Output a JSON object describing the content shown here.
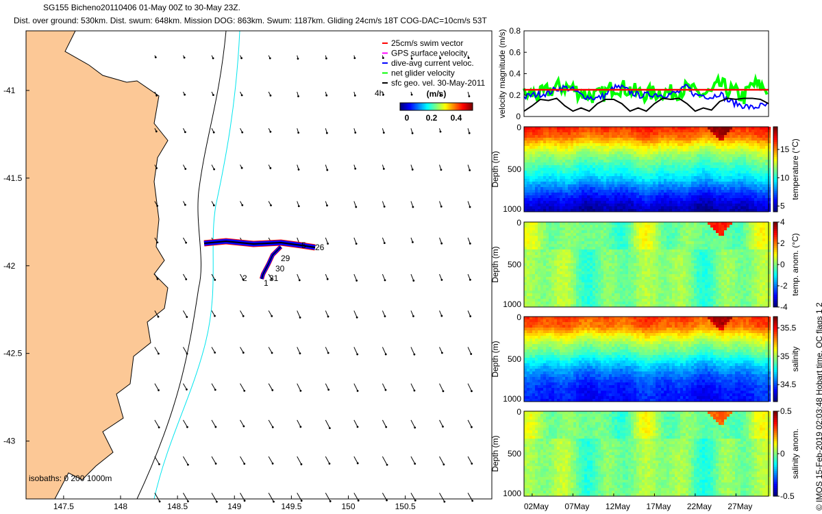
{
  "title": {
    "line1": "SG155 Bicheno20110406 01-May 00Z to 30-May 23Z.",
    "line2": "Dist. over ground: 530km. Dist. swum: 648km. Mission DOG: 863km. Swum: 1187km. Gliding 24cm/s 18T COG-DAC=10cm/s 53T"
  },
  "side_note": "© IMOS 15-Feb-2019 02:03:48 Hobart time. QC flags 1  2",
  "colors": {
    "land": "#fcc896",
    "isobath_200": "#000000",
    "isobath_1000": "#00e5ee",
    "swim": "#ff0000",
    "gps": "#ff00ff",
    "dac": "#0000ff",
    "net": "#00ff00",
    "geo": "#000000"
  },
  "chart_data": [
    {
      "type": "map",
      "xticks": [
        "147.5",
        "148",
        "148.5",
        "149",
        "149.5",
        "150",
        "150.5"
      ],
      "yticks": [
        "-41",
        "-41.5",
        "-42",
        "-42.5",
        "-43"
      ],
      "xlim": [
        147.17,
        151.26
      ],
      "ylim": [
        -43.33,
        -40.66
      ],
      "legend": {
        "placement": "top-right",
        "entries": [
          "25cm/s swim vector",
          "GPS surface velocity",
          "dive-avg current veloc.",
          "net glider velocity",
          "sfc geo. vel. 30-May-2011"
        ],
        "colorbar_title": "(m/s)",
        "colorbar_ticks": [
          "0",
          "0.2",
          "0.4"
        ]
      },
      "isobaths_label": "isobaths: 0   200  1000m",
      "track_labels": [
        "5",
        "26",
        "29",
        "30",
        "2",
        "31",
        "1",
        "4h"
      ]
    },
    {
      "type": "line",
      "ylabel": "velocity magnitude (m/s)",
      "ylim": [
        0,
        0.8
      ],
      "yticks": [
        "0",
        "0.2",
        "0.4",
        "0.6",
        "0.8"
      ],
      "x_days_may": [
        1,
        2,
        3,
        4,
        5,
        6,
        7,
        8,
        9,
        10,
        11,
        12,
        13,
        14,
        15,
        16,
        17,
        18,
        19,
        20,
        21,
        22,
        23,
        24,
        25,
        26,
        27,
        28,
        29,
        30,
        31
      ],
      "series": [
        {
          "key": "net",
          "values": [
            0.2,
            0.21,
            0.2,
            0.24,
            0.27,
            0.28,
            0.26,
            0.22,
            0.2,
            0.19,
            0.22,
            0.28,
            0.27,
            0.25,
            0.22,
            0.21,
            0.22,
            0.23,
            0.22,
            0.24,
            0.26,
            0.22,
            0.21,
            0.22,
            0.3,
            0.25,
            0.22,
            0.18,
            0.3,
            0.28,
            0.25
          ]
        },
        {
          "key": "dac",
          "values": [
            0.18,
            0.2,
            0.21,
            0.22,
            0.26,
            0.27,
            0.25,
            0.2,
            0.18,
            0.17,
            0.2,
            0.27,
            0.27,
            0.23,
            0.2,
            0.2,
            0.21,
            0.2,
            0.21,
            0.23,
            0.28,
            0.2,
            0.2,
            0.18,
            0.22,
            0.15,
            0.12,
            0.1,
            0.08,
            0.1,
            0.1
          ]
        },
        {
          "key": "swim",
          "values": [
            0.25,
            0.25,
            0.25,
            0.25,
            0.25,
            0.25,
            0.25,
            0.25,
            0.25,
            0.25,
            0.25,
            0.25,
            0.25,
            0.25,
            0.25,
            0.25,
            0.25,
            0.25,
            0.25,
            0.25,
            0.25,
            0.25,
            0.25,
            0.25,
            0.25,
            0.25,
            0.25,
            0.25,
            0.25,
            0.25,
            0.25
          ]
        },
        {
          "key": "geo",
          "values": [
            0.05,
            0.1,
            0.16,
            0.15,
            0.17,
            0.1,
            0.05,
            0.08,
            0.05,
            0.12,
            0.16,
            0.16,
            0.12,
            0.05,
            0.08,
            0.05,
            0.12,
            0.17,
            0.16,
            0.17,
            0.12,
            0.05,
            0.08,
            0.06,
            0.14,
            0.17,
            0.16,
            0.17,
            0.17,
            0.16,
            0.12
          ]
        }
      ]
    },
    {
      "type": "heatmap",
      "ylabel": "Depth (m)",
      "clabel": "temperature (°C)",
      "ylim": [
        1000,
        0
      ],
      "clim": [
        4,
        19
      ],
      "yticks": [
        "0",
        "500",
        "1000"
      ],
      "cticks": [
        "5",
        "10",
        "15"
      ],
      "profile_depth": [
        0,
        100,
        200,
        300,
        400,
        500,
        600,
        700,
        800,
        900,
        1000
      ],
      "profile_values": [
        16.5,
        15.5,
        13.5,
        12,
        11,
        10,
        9,
        7.5,
        6.2,
        5.2,
        4.5
      ],
      "feature": {
        "day": 25,
        "depth_max": 150,
        "delta": 2.5
      }
    },
    {
      "type": "heatmap",
      "ylabel": "Depth (m)",
      "clabel": "temp. anom. (°C)",
      "ylim": [
        1000,
        0
      ],
      "clim": [
        -4,
        4
      ],
      "yticks": [
        "0",
        "500",
        "1000"
      ],
      "cticks": [
        "-4",
        "-2",
        "0",
        "2",
        "4"
      ],
      "profile_depth": [
        0,
        1000
      ],
      "profile_values": [
        0,
        0
      ],
      "feature": {
        "day": 25,
        "depth_max": 150,
        "delta": 3
      }
    },
    {
      "type": "heatmap",
      "ylabel": "Depth (m)",
      "clabel": "salinity",
      "ylim": [
        1000,
        0
      ],
      "clim": [
        34.2,
        35.7
      ],
      "yticks": [
        "0",
        "500",
        "1000"
      ],
      "cticks": [
        "34.5",
        "35",
        "35.5"
      ],
      "profile_depth": [
        0,
        100,
        200,
        300,
        400,
        500,
        600,
        700,
        800,
        900,
        1000
      ],
      "profile_values": [
        35.4,
        35.35,
        35.15,
        35.0,
        34.9,
        34.75,
        34.62,
        34.52,
        34.45,
        34.42,
        34.4
      ],
      "feature": {
        "day": 25,
        "depth_max": 150,
        "delta": 0.25
      }
    },
    {
      "type": "heatmap",
      "ylabel": "Depth (m)",
      "clabel": "salinity anom.",
      "ylim": [
        1000,
        0
      ],
      "clim": [
        -0.5,
        0.5
      ],
      "yticks": [
        "0",
        "500",
        "1000"
      ],
      "cticks": [
        "-0.5",
        "0",
        "0.5"
      ],
      "xticks": [
        "02May",
        "07May",
        "12May",
        "17May",
        "22May",
        "27May"
      ],
      "profile_depth": [
        0,
        1000
      ],
      "profile_values": [
        0,
        0
      ],
      "feature": {
        "day": 25,
        "depth_max": 150,
        "delta": 0.3
      }
    }
  ]
}
